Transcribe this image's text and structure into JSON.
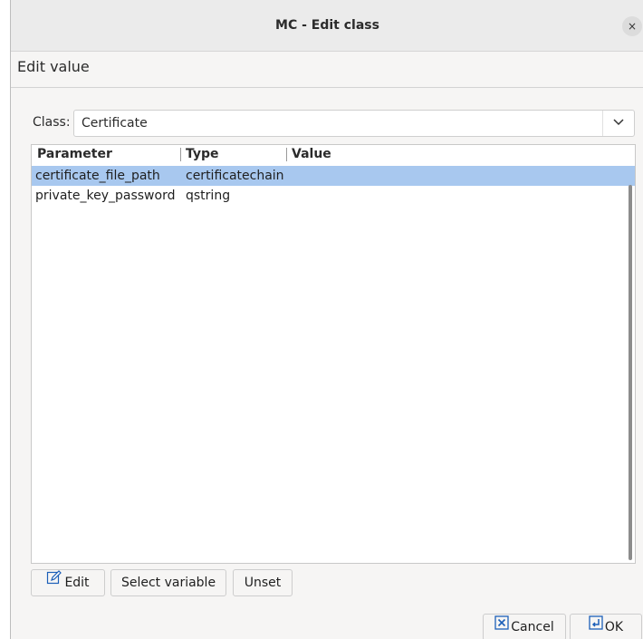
{
  "window": {
    "title": "MC - Edit class",
    "close_label": "×"
  },
  "section": {
    "title": "Edit value"
  },
  "class_selector": {
    "label": "Class:",
    "value": "Certificate",
    "arrow": "⌵"
  },
  "table": {
    "columns": [
      "Parameter",
      "Type",
      "Value"
    ],
    "rows": [
      {
        "parameter": "certificate_file_path",
        "type": "certificatechain",
        "value": "",
        "selected": true
      },
      {
        "parameter": "private_key_password",
        "type": "qstring",
        "value": "",
        "selected": false
      }
    ]
  },
  "actions": {
    "edit": "Edit",
    "select_variable": "Select variable",
    "unset": "Unset"
  },
  "dialog_buttons": {
    "cancel": "Cancel",
    "ok": "OK"
  },
  "icons": {
    "edit": "pencil-icon",
    "cancel": "x-box-icon",
    "ok": "enter-icon"
  },
  "colors": {
    "selection": "#a8c8ef",
    "accent": "#1c5fb8"
  }
}
